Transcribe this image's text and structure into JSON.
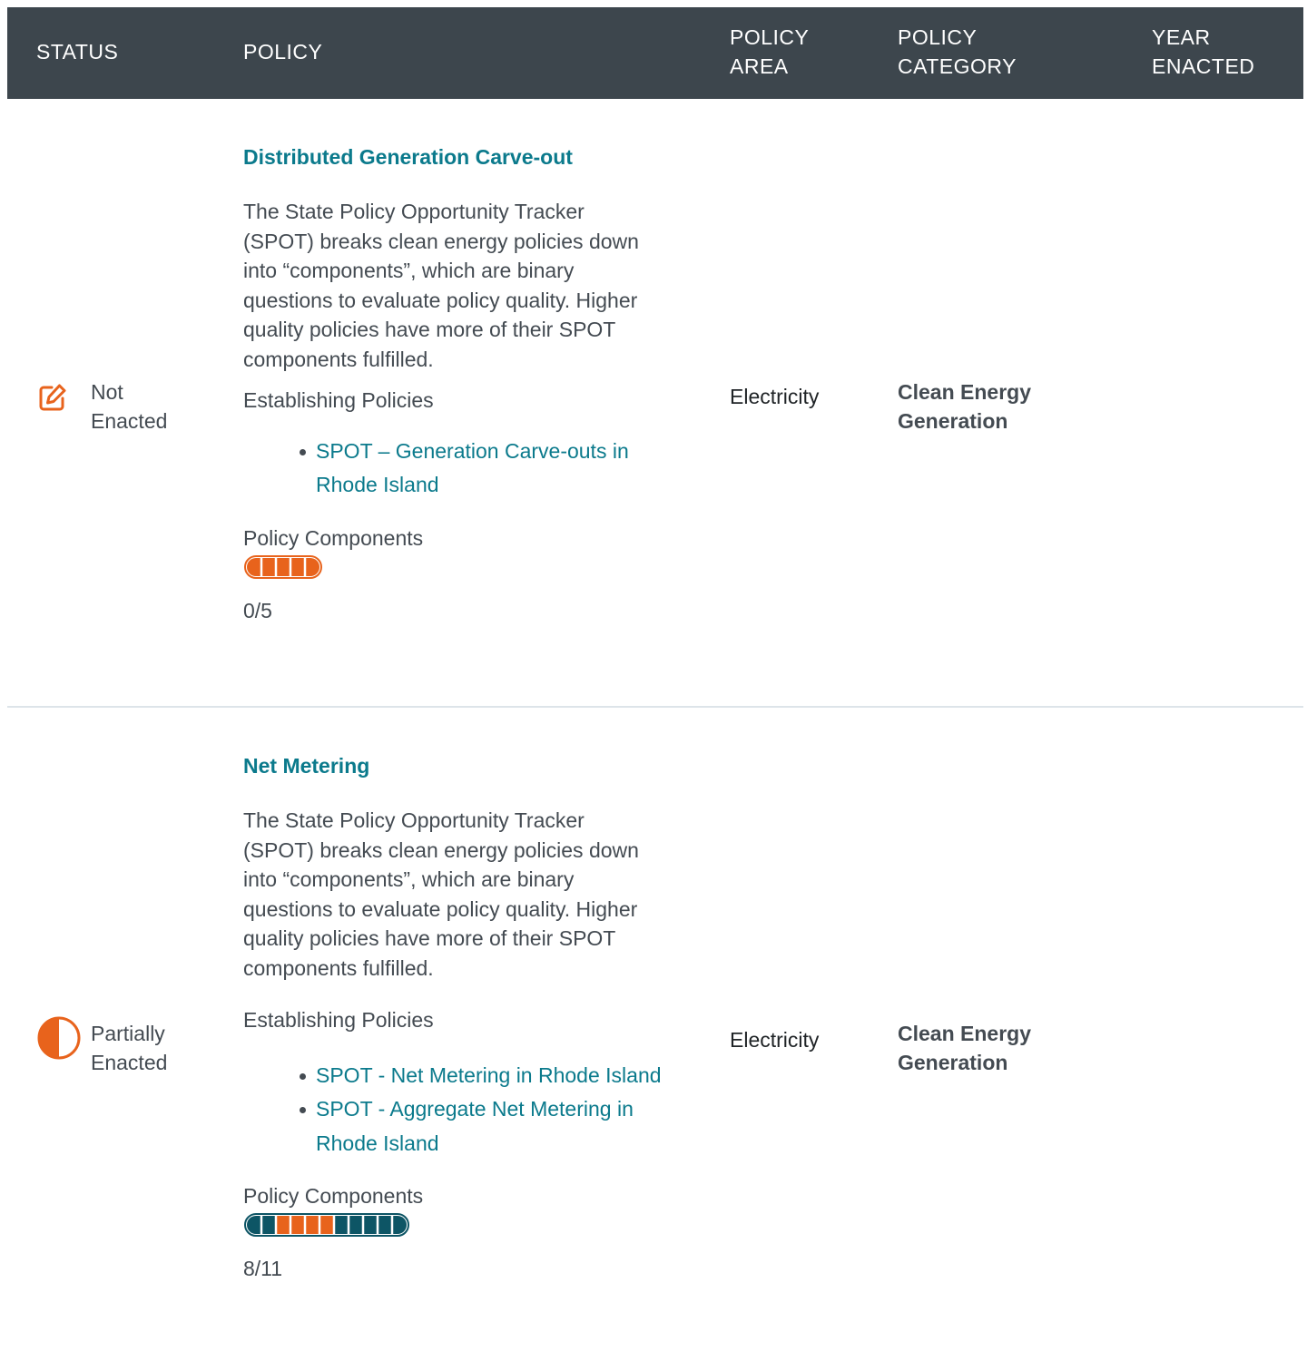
{
  "header": {
    "status": "STATUS",
    "policy": "POLICY",
    "area_line1": "POLICY",
    "area_line2": "AREA",
    "category_line1": "POLICY",
    "category_line2": "CATEGORY",
    "year_line1": "YEAR",
    "year_line2": "ENACTED"
  },
  "colors": {
    "header_bg": "#3d464d",
    "link": "#0b7a8c",
    "orange": "#e8631c",
    "teal_dark": "#0d5565"
  },
  "rows": [
    {
      "status_icon": "edit-square-icon",
      "status_line1": "Not",
      "status_line2": "Enacted",
      "title": "Distributed Generation Carve-out",
      "description": "The State Policy Opportunity Tracker (SPOT) breaks clean energy policies down into “components”, which are binary questions to evaluate policy quality. Higher quality policies have more of their SPOT components fulfilled.",
      "establishing_label": "Establishing Policies",
      "links": [
        "SPOT – Generation Carve-outs in Rhode Island"
      ],
      "components_label": "Policy Components",
      "components_text": "0/5",
      "components_total": 5,
      "components_fulfilled": 0,
      "area": "Electricity",
      "category_line1": "Clean Energy",
      "category_line2": "Generation",
      "year": ""
    },
    {
      "status_icon": "half-circle-icon",
      "status_line1": "Partially",
      "status_line2": "Enacted",
      "title": "Net Metering",
      "description": "The State Policy Opportunity Tracker (SPOT) breaks clean energy policies down into “components”, which are binary questions to evaluate policy quality. Higher quality policies have more of their SPOT components fulfilled.",
      "establishing_label": "Establishing Policies",
      "links": [
        "SPOT - Net Metering in Rhode Island",
        "SPOT - Aggregate Net Metering in Rhode Island"
      ],
      "components_label": "Policy Components",
      "components_text": "8/11",
      "components_total": 11,
      "components_fulfilled": 8,
      "area": "Electricity",
      "category_line1": "Clean Energy",
      "category_line2": "Generation",
      "year": ""
    }
  ]
}
